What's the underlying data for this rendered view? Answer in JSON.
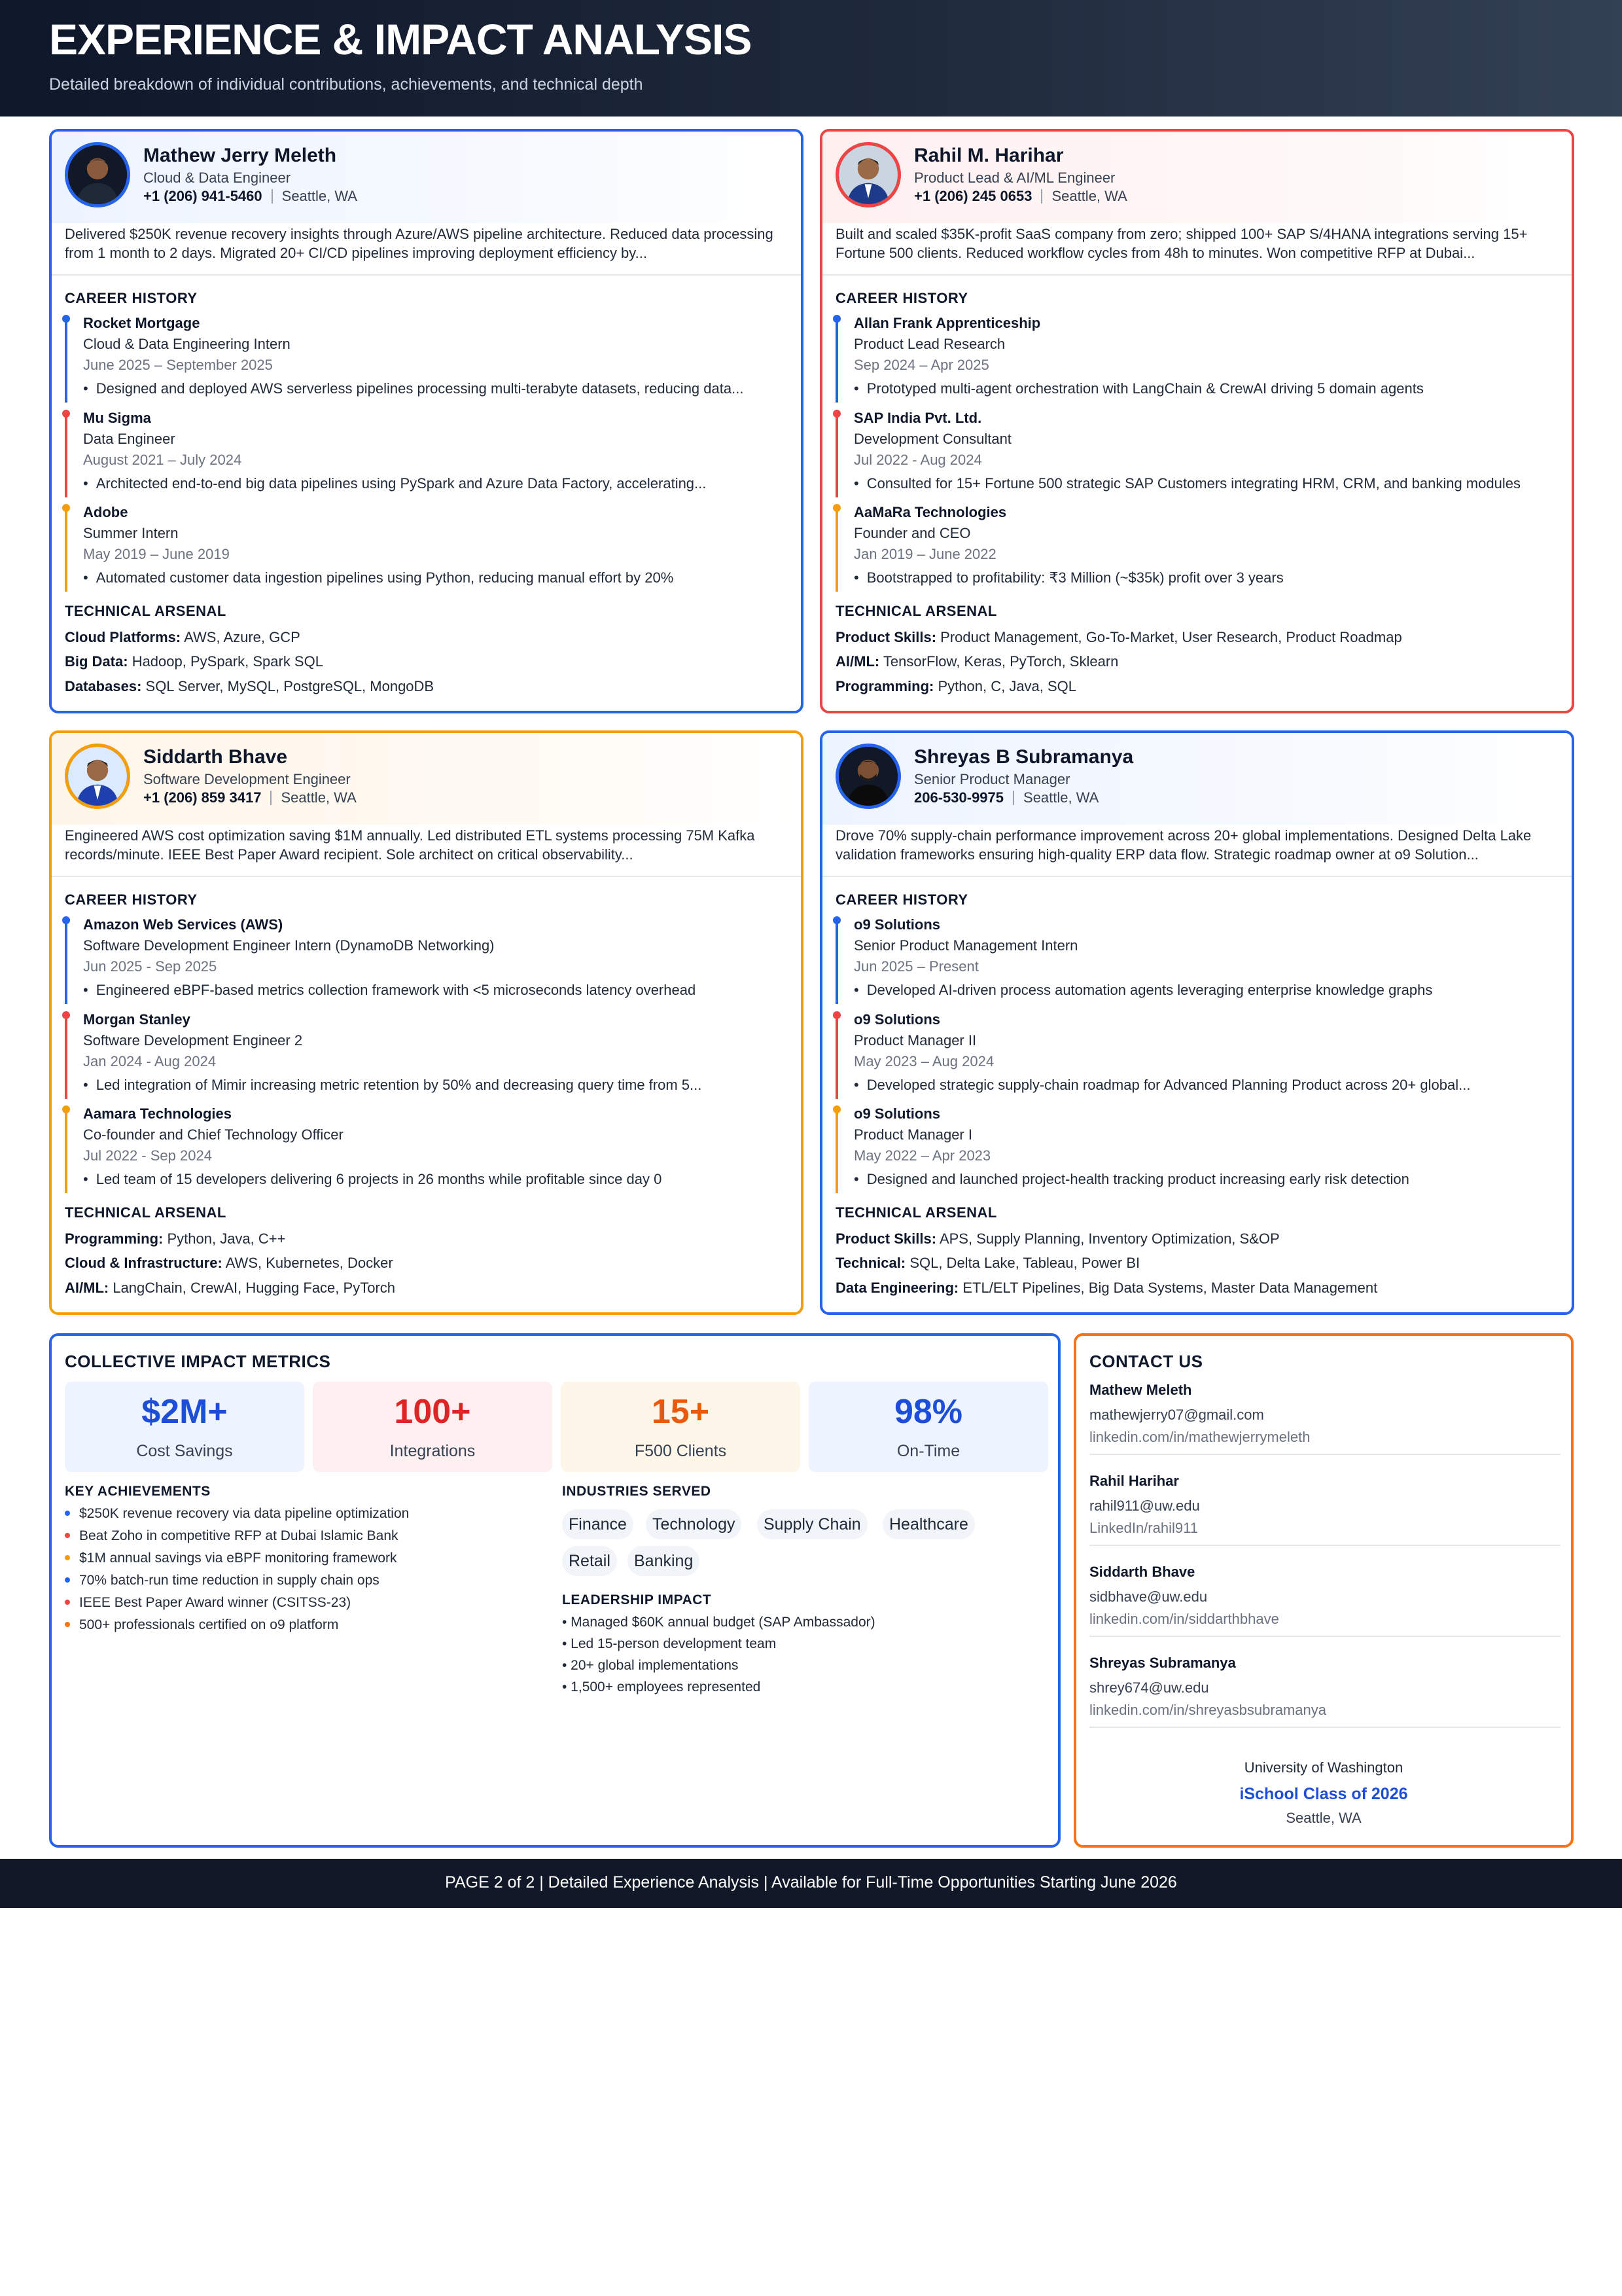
{
  "header": {
    "title": "EXPERIENCE & IMPACT ANALYSIS",
    "subtitle": "Detailed breakdown of individual contributions, achievements, and technical depth"
  },
  "profiles": [
    {
      "name": "Mathew Jerry Meleth",
      "role": "Cloud & Data Engineer",
      "phone": "+1 (206) 941-5460",
      "location": "Seattle, WA",
      "summary": "Delivered $250K revenue recovery insights through Azure/AWS pipeline architecture. Reduced data processing from 1 month to 2 days. Migrated 20+ CI/CD pipelines improving deployment efficiency by...",
      "career_title": "CAREER HISTORY",
      "jobs": [
        {
          "company": "Rocket Mortgage",
          "title": "Cloud & Data Engineering Intern",
          "dates": "June 2025 – September 2025",
          "bullet": "Designed and deployed AWS serverless pipelines processing multi-terabyte datasets, reducing data..."
        },
        {
          "company": "Mu Sigma",
          "title": "Data Engineer",
          "dates": "August 2021 – July 2024",
          "bullet": "Architected end-to-end big data pipelines using PySpark and Azure Data Factory, accelerating..."
        },
        {
          "company": "Adobe",
          "title": "Summer Intern",
          "dates": "May 2019 – June 2019",
          "bullet": "Automated customer data ingestion pipelines using Python, reducing manual effort by 20%"
        }
      ],
      "tech_title": "TECHNICAL ARSENAL",
      "skills": [
        {
          "label": "Cloud Platforms:",
          "value": "AWS, Azure, GCP"
        },
        {
          "label": "Big Data:",
          "value": "Hadoop, PySpark, Spark SQL"
        },
        {
          "label": "Databases:",
          "value": "SQL Server, MySQL, PostgreSQL, MongoDB"
        }
      ]
    },
    {
      "name": "Rahil M. Harihar",
      "role": "Product Lead & AI/ML Engineer",
      "phone": "+1 (206) 245 0653",
      "location": "Seattle, WA",
      "summary": "Built and scaled $35K-profit SaaS company from zero; shipped 100+ SAP S/4HANA integrations serving 15+ Fortune 500 clients. Reduced workflow cycles from 48h to minutes. Won competitive RFP at Dubai...",
      "career_title": "CAREER HISTORY",
      "jobs": [
        {
          "company": "Allan Frank Apprenticeship",
          "title": "Product Lead Research",
          "dates": "Sep 2024 – Apr 2025",
          "bullet": "Prototyped multi-agent orchestration with LangChain & CrewAI driving 5 domain agents"
        },
        {
          "company": "SAP India Pvt. Ltd.",
          "title": "Development Consultant",
          "dates": "Jul 2022 - Aug 2024",
          "bullet": "Consulted for 15+ Fortune 500 strategic SAP Customers integrating HRM, CRM, and banking modules"
        },
        {
          "company": "AaMaRa Technologies",
          "title": "Founder and CEO",
          "dates": "Jan 2019 – June 2022",
          "bullet": "Bootstrapped to profitability: ₹3 Million (~$35k) profit over 3 years"
        }
      ],
      "tech_title": "TECHNICAL ARSENAL",
      "skills": [
        {
          "label": "Product Skills:",
          "value": "Product Management, Go-To-Market, User Research, Product Roadmap"
        },
        {
          "label": "AI/ML:",
          "value": "TensorFlow, Keras, PyTorch, Sklearn"
        },
        {
          "label": "Programming:",
          "value": "Python, C, Java, SQL"
        }
      ]
    },
    {
      "name": "Siddarth Bhave",
      "role": "Software Development Engineer",
      "phone": "+1 (206) 859 3417",
      "location": "Seattle, WA",
      "summary": "Engineered AWS cost optimization saving $1M annually. Led distributed ETL systems processing 75M Kafka records/minute. IEEE Best Paper Award recipient. Sole architect on critical observability...",
      "career_title": "CAREER HISTORY",
      "jobs": [
        {
          "company": "Amazon Web Services (AWS)",
          "title": "Software Development Engineer Intern (DynamoDB Networking)",
          "dates": "Jun 2025 - Sep 2025",
          "bullet": "Engineered eBPF-based metrics collection framework with <5 microseconds latency overhead"
        },
        {
          "company": "Morgan Stanley",
          "title": "Software Development Engineer 2",
          "dates": "Jan 2024 - Aug 2024",
          "bullet": "Led integration of Mimir increasing metric retention by 50% and decreasing query time from 5..."
        },
        {
          "company": "Aamara Technologies",
          "title": "Co-founder and Chief Technology Officer",
          "dates": "Jul 2022 - Sep 2024",
          "bullet": "Led team of 15 developers delivering 6 projects in 26 months while profitable since day 0"
        }
      ],
      "tech_title": "TECHNICAL ARSENAL",
      "skills": [
        {
          "label": "Programming:",
          "value": "Python, Java, C++"
        },
        {
          "label": "Cloud & Infrastructure:",
          "value": "AWS, Kubernetes, Docker"
        },
        {
          "label": "AI/ML:",
          "value": "LangChain, CrewAI, Hugging Face, PyTorch"
        }
      ]
    },
    {
      "name": "Shreyas B Subramanya",
      "role": "Senior Product Manager",
      "phone": "206-530-9975",
      "location": "Seattle, WA",
      "summary": "Drove 70% supply-chain performance improvement across 20+ global implementations. Designed Delta Lake validation frameworks ensuring high-quality ERP data flow. Strategic roadmap owner at o9 Solution...",
      "career_title": "CAREER HISTORY",
      "jobs": [
        {
          "company": "o9 Solutions",
          "title": "Senior Product Management Intern",
          "dates": "Jun 2025 – Present",
          "bullet": "Developed AI-driven process automation agents leveraging enterprise knowledge graphs"
        },
        {
          "company": "o9 Solutions",
          "title": "Product Manager II",
          "dates": "May 2023 – Aug 2024",
          "bullet": "Developed strategic supply-chain roadmap for Advanced Planning Product across 20+ global..."
        },
        {
          "company": "o9 Solutions",
          "title": "Product Manager I",
          "dates": "May 2022 – Apr 2023",
          "bullet": "Designed and launched project-health tracking product increasing early risk detection"
        }
      ],
      "tech_title": "TECHNICAL ARSENAL",
      "skills": [
        {
          "label": "Product Skills:",
          "value": "APS, Supply Planning, Inventory Optimization, S&OP"
        },
        {
          "label": "Technical:",
          "value": "SQL, Delta Lake, Tableau, Power BI"
        },
        {
          "label": "Data Engineering:",
          "value": "ETL/ELT Pipelines, Big Data Systems, Master Data Management"
        }
      ]
    }
  ],
  "metrics": {
    "title": "COLLECTIVE IMPACT METRICS",
    "boxes": [
      {
        "value": "$2M+",
        "label": "Cost Savings",
        "color": "#1d4ed8",
        "bg": "#eef4ff"
      },
      {
        "value": "100+",
        "label": "Integrations",
        "color": "#dc2626",
        "bg": "#fef0f0"
      },
      {
        "value": "15+",
        "label": "F500 Clients",
        "color": "#ea580c",
        "bg": "#fff6ea"
      },
      {
        "value": "98%",
        "label": "On-Time",
        "color": "#1d4ed8",
        "bg": "#eef4ff"
      }
    ],
    "achievements_title": "KEY ACHIEVEMENTS",
    "achievements": [
      {
        "text": "$250K revenue recovery via data pipeline optimization",
        "color": "#2563eb"
      },
      {
        "text": "Beat Zoho in competitive RFP at Dubai Islamic Bank",
        "color": "#ef4444"
      },
      {
        "text": "$1M annual savings via eBPF monitoring framework",
        "color": "#f59e0b"
      },
      {
        "text": "70% batch-run time reduction in supply chain ops",
        "color": "#2563eb"
      },
      {
        "text": "IEEE Best Paper Award winner (CSITSS-23)",
        "color": "#ef4444"
      },
      {
        "text": "500+ professionals certified on o9 platform",
        "color": "#f97316"
      }
    ],
    "industries_title": "INDUSTRIES SERVED",
    "industries": [
      "Finance",
      "Technology",
      "Supply Chain",
      "Healthcare",
      "Retail",
      "Banking"
    ],
    "leadership_title": "LEADERSHIP IMPACT",
    "leadership": [
      "• Managed $60K annual budget (SAP Ambassador)",
      "• Led 15-person development team",
      "• 20+ global implementations",
      "• 1,500+ employees represented"
    ]
  },
  "contact": {
    "title": "CONTACT US",
    "people": [
      {
        "name": "Mathew Meleth",
        "email": "mathewjerry07@gmail.com",
        "link": "linkedin.com/in/mathewjerrymeleth"
      },
      {
        "name": "Rahil Harihar",
        "email": "rahil911@uw.edu",
        "link": "LinkedIn/rahil911"
      },
      {
        "name": "Siddarth Bhave",
        "email": "sidbhave@uw.edu",
        "link": "linkedin.com/in/siddarthbhave"
      },
      {
        "name": "Shreyas Subramanya",
        "email": "shrey674@uw.edu",
        "link": "linkedin.com/in/shreyasbsubramanya"
      }
    ],
    "university": "University of Washington",
    "class": "iSchool Class of 2026",
    "city": "Seattle, WA"
  },
  "footer": {
    "text": "PAGE 2 of 2 | Detailed Experience Analysis | Available for Full-Time Opportunities Starting June 2026"
  }
}
